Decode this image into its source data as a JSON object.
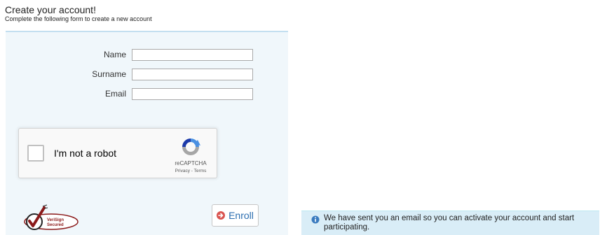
{
  "header": {
    "title": "Create your account!",
    "subtitle": "Complete the following form to create a new account"
  },
  "form": {
    "fields": [
      {
        "label": "Name",
        "value": "",
        "placeholder": ""
      },
      {
        "label": "Surname",
        "value": "",
        "placeholder": ""
      },
      {
        "label": "Email",
        "value": "",
        "placeholder": ""
      }
    ]
  },
  "recaptcha": {
    "label": "I'm not a robot",
    "brand": "reCAPTCHA",
    "links": "Privacy - Terms",
    "checked": false,
    "icon": "recaptcha-logo-icon"
  },
  "seal": {
    "text": "VeriSign Secured",
    "icon": "checkmark-seal-icon"
  },
  "enroll_button": {
    "label": "Enroll",
    "icon": "arrow-circle-right-icon",
    "color": "#2a6db0",
    "icon_color": "#d9534f"
  },
  "alert": {
    "text": "We have sent you an email so you can activate your account and start participating.",
    "icon": "info-circle-icon",
    "background": "#d9edf7"
  }
}
